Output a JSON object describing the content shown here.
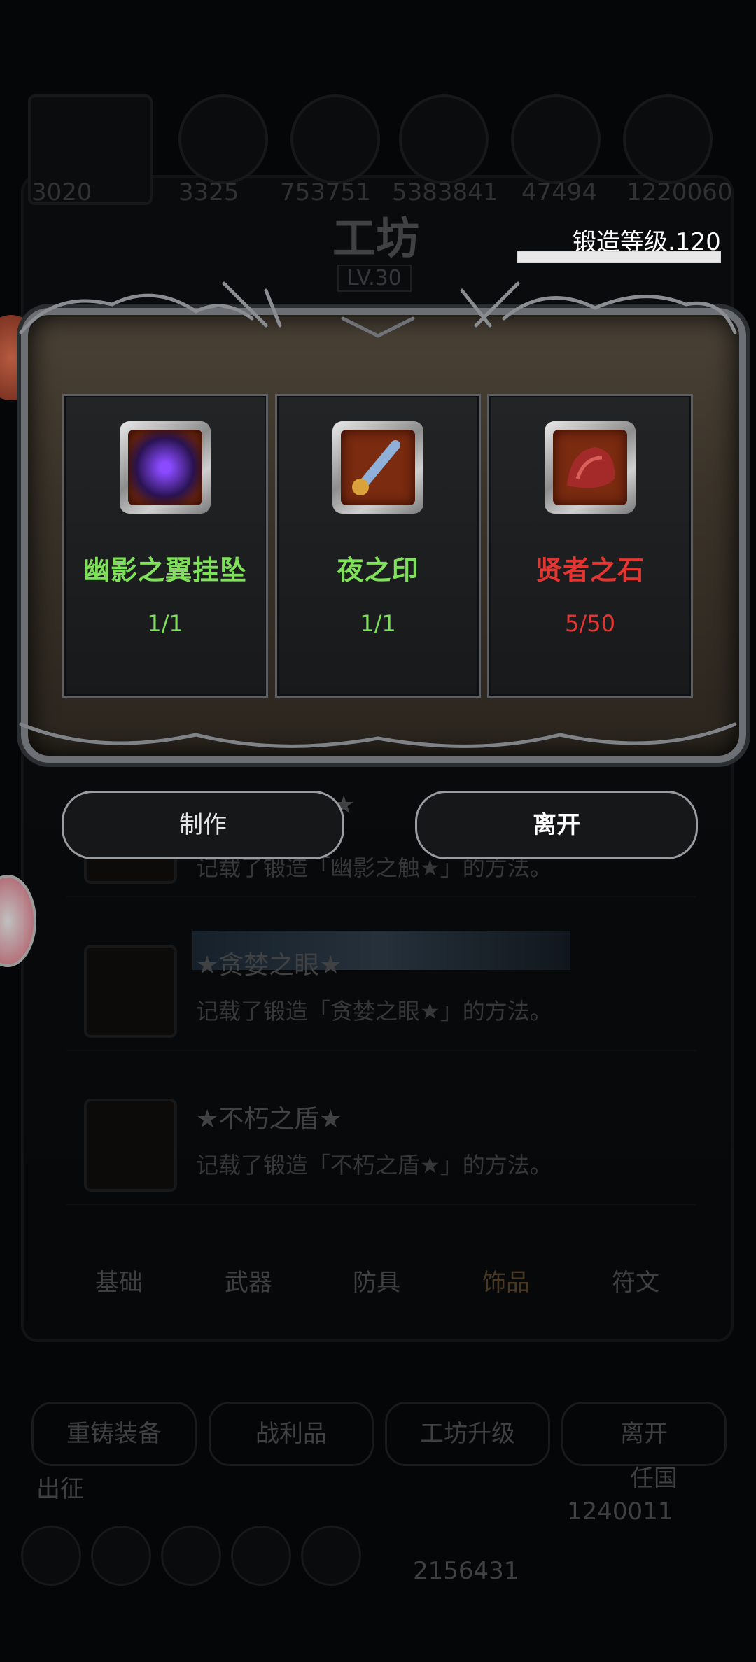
{
  "background": {
    "stats": [
      "3020",
      "3325",
      "753751",
      "5383841",
      "47494",
      "1220060"
    ],
    "title": "工坊",
    "level": "LV.30",
    "recipes": [
      {
        "title": "★",
        "desc": "记载了锻造「幽影之触★」的方法。"
      },
      {
        "title": "★贪婪之眼★",
        "desc": "记载了锻造「贪婪之眼★」的方法。"
      },
      {
        "title": "★不朽之盾★",
        "desc": "记载了锻造「不朽之盾★」的方法。"
      }
    ],
    "tabs": [
      "基础",
      "武器",
      "防具",
      "饰品",
      "符文"
    ],
    "bottom_buttons": [
      "重铸装备",
      "战利品",
      "工坊升级",
      "离开"
    ],
    "bottom_left_label": "出征",
    "bottom_right_label": "任国",
    "bottom_counts": [
      "1240011",
      "2156431"
    ]
  },
  "forge": {
    "level_label": "锻造等级.120",
    "progress": 1.0
  },
  "materials": [
    {
      "name": "幽影之翼挂坠",
      "count": "1/1",
      "status": "enough",
      "icon": "shadow-wing-pendant-icon"
    },
    {
      "name": "夜之印",
      "count": "1/1",
      "status": "enough",
      "icon": "night-seal-icon"
    },
    {
      "name": "贤者之石",
      "count": "5/50",
      "status": "insufficient",
      "icon": "sage-stone-icon"
    }
  ],
  "actions": {
    "craft": "制作",
    "leave": "离开"
  },
  "colors": {
    "enough": "#7fe05a",
    "insufficient": "#e53530"
  }
}
